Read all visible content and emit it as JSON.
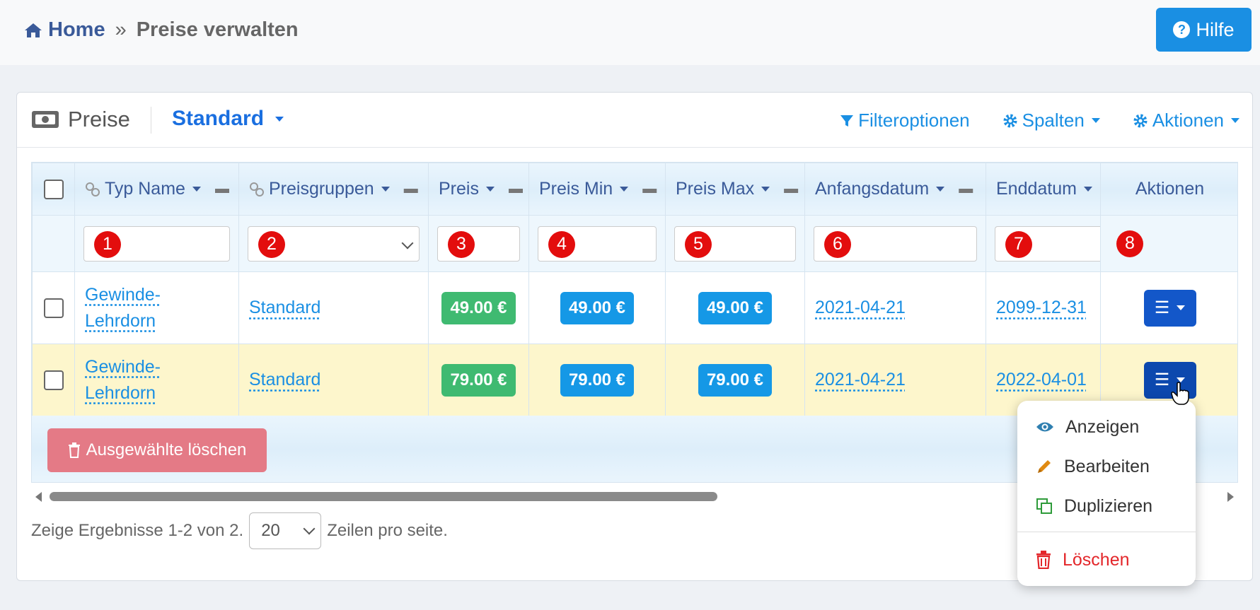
{
  "breadcrumb": {
    "home": "Home",
    "separator": "»",
    "current": "Preise verwalten"
  },
  "help_button": {
    "label": "Hilfe"
  },
  "card": {
    "title": "Preise",
    "view": "Standard",
    "actions": {
      "filter": "Filteroptionen",
      "columns": "Spalten",
      "actions": "Aktionen"
    }
  },
  "table": {
    "columns": {
      "typ_name": "Typ Name",
      "preisgruppen": "Preisgruppen",
      "preis": "Preis",
      "preis_min": "Preis Min",
      "preis_max": "Preis Max",
      "anfangsdatum": "Anfangsdatum",
      "enddatum": "Enddatum",
      "aktionen": "Aktionen"
    },
    "filter_badges": [
      "1",
      "2",
      "3",
      "4",
      "5",
      "6",
      "7",
      "8"
    ],
    "rows": [
      {
        "typ_line1": "Gewinde-",
        "typ_line2": "Lehrdorn",
        "gruppe": "Standard",
        "preis": "49.00 €",
        "preis_min": "49.00 €",
        "preis_max": "49.00 €",
        "start": "2021-04-21",
        "end": "2099-12-31"
      },
      {
        "typ_line1": "Gewinde-",
        "typ_line2": "Lehrdorn",
        "gruppe": "Standard",
        "preis": "79.00 €",
        "preis_min": "79.00 €",
        "preis_max": "79.00 €",
        "start": "2021-04-21",
        "end": "2022-04-01"
      }
    ],
    "delete_selected": "Ausgewählte löschen"
  },
  "pagination": {
    "prefix": "Zeige Ergebnisse 1-2 von 2.",
    "per_page": "20",
    "suffix": "Zeilen pro seite."
  },
  "dropdown": {
    "show": "Anzeigen",
    "edit": "Bearbeiten",
    "duplicate": "Duplizieren",
    "delete": "Löschen"
  },
  "colors": {
    "accent": "#1a8fe3",
    "green": "#3fba71",
    "danger": "#e3262a",
    "highlight": "#fdf6cc"
  }
}
